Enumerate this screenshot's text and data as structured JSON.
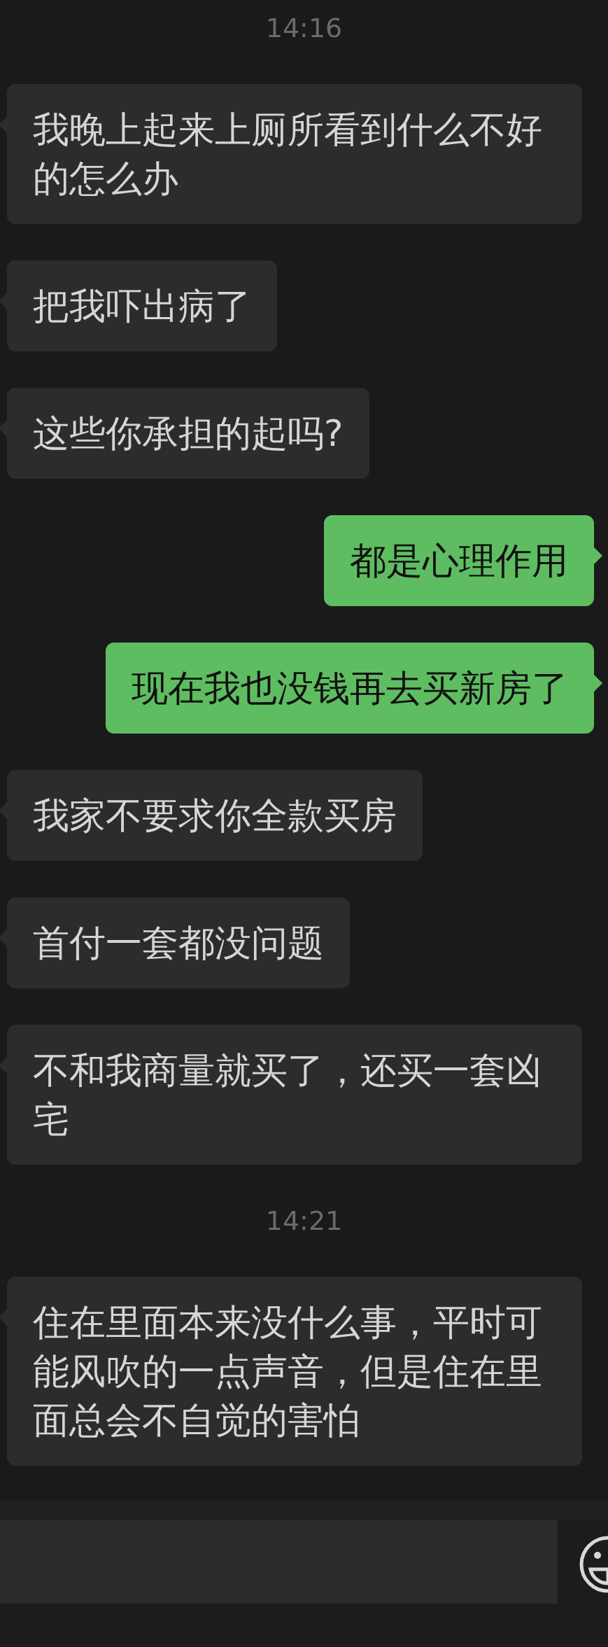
{
  "messages": [
    {
      "kind": "time",
      "text": "14:16"
    },
    {
      "kind": "received",
      "text": "我晚上起来上厕所看到什么不好的怎么办"
    },
    {
      "kind": "received",
      "text": "把我吓出病了"
    },
    {
      "kind": "received",
      "text": "这些你承担的起吗?"
    },
    {
      "kind": "sent",
      "text": "都是心理作用"
    },
    {
      "kind": "sent",
      "text": "现在我也没钱再去买新房了"
    },
    {
      "kind": "received",
      "text": "我家不要求你全款买房"
    },
    {
      "kind": "received",
      "text": "首付一套都没问题"
    },
    {
      "kind": "received",
      "text": "不和我商量就买了，还买一套凶宅"
    },
    {
      "kind": "time",
      "text": "14:21"
    },
    {
      "kind": "received",
      "text": "住在里面本来没什么事，平时可能风吹的一点声音，但是住在里面总会不自觉的害怕"
    }
  ]
}
